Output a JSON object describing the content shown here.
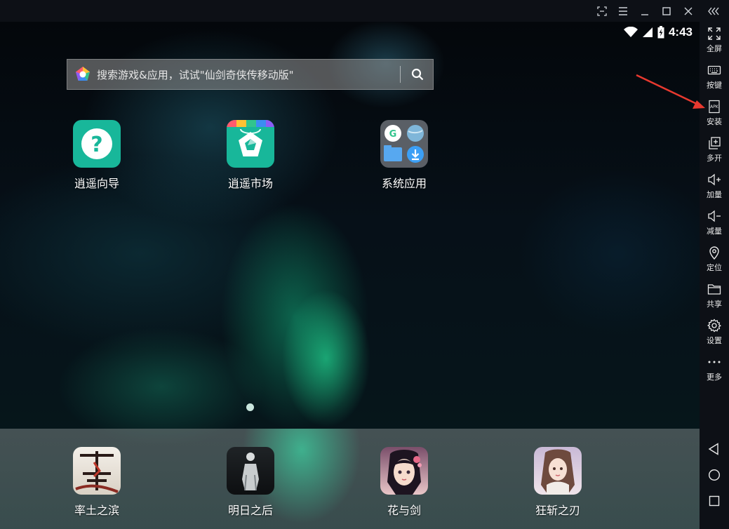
{
  "titlebar": {
    "buttons": [
      {
        "name": "screenshot-button",
        "icon": "screenshot-icon"
      },
      {
        "name": "menu-button",
        "icon": "menu-icon"
      },
      {
        "name": "minimize-button",
        "icon": "minimize-icon"
      },
      {
        "name": "maximize-button",
        "icon": "maximize-icon"
      },
      {
        "name": "close-button",
        "icon": "close-icon"
      },
      {
        "name": "collapse-sidebar-button",
        "icon": "double-chevron-left-icon"
      }
    ]
  },
  "statusbar": {
    "time": "4:43",
    "icons": [
      "wifi-icon",
      "signal-icon",
      "battery-charging-icon"
    ]
  },
  "search": {
    "placeholder": "搜索游戏&应用，试试\"仙剑奇侠传移动版\"",
    "icon": "search-icon"
  },
  "home_apps": [
    {
      "label": "逍遥向导",
      "icon": "help-guide-icon",
      "color": "#18b79a"
    },
    {
      "label": "逍遥市场",
      "icon": "market-icon",
      "color": "#18b79a"
    },
    {
      "label": "系统应用",
      "icon": "folder-icon",
      "color": "#5a5f66"
    }
  ],
  "dock_apps": [
    {
      "label": "率土之滨",
      "icon": "game-icon"
    },
    {
      "label": "明日之后",
      "icon": "game-icon"
    },
    {
      "label": "花与剑",
      "icon": "game-icon"
    },
    {
      "label": "狂斩之刃",
      "icon": "game-icon"
    }
  ],
  "sidebar": {
    "items": [
      {
        "label": "全屏",
        "icon": "fullscreen-icon"
      },
      {
        "label": "按键",
        "icon": "keyboard-icon"
      },
      {
        "label": "安装",
        "icon": "apk-icon",
        "icon_text": "APK"
      },
      {
        "label": "多开",
        "icon": "multi-instance-icon"
      },
      {
        "label": "加量",
        "icon": "volume-up-icon"
      },
      {
        "label": "减量",
        "icon": "volume-down-icon"
      },
      {
        "label": "定位",
        "icon": "location-icon"
      },
      {
        "label": "共享",
        "icon": "folder-share-icon"
      },
      {
        "label": "设置",
        "icon": "gear-icon"
      },
      {
        "label": "更多",
        "icon": "more-icon"
      }
    ],
    "nav": [
      "back-icon",
      "home-icon",
      "recents-icon"
    ]
  },
  "colors": {
    "accent_teal": "#18b79a",
    "annotation_arrow": "#e8392f"
  }
}
